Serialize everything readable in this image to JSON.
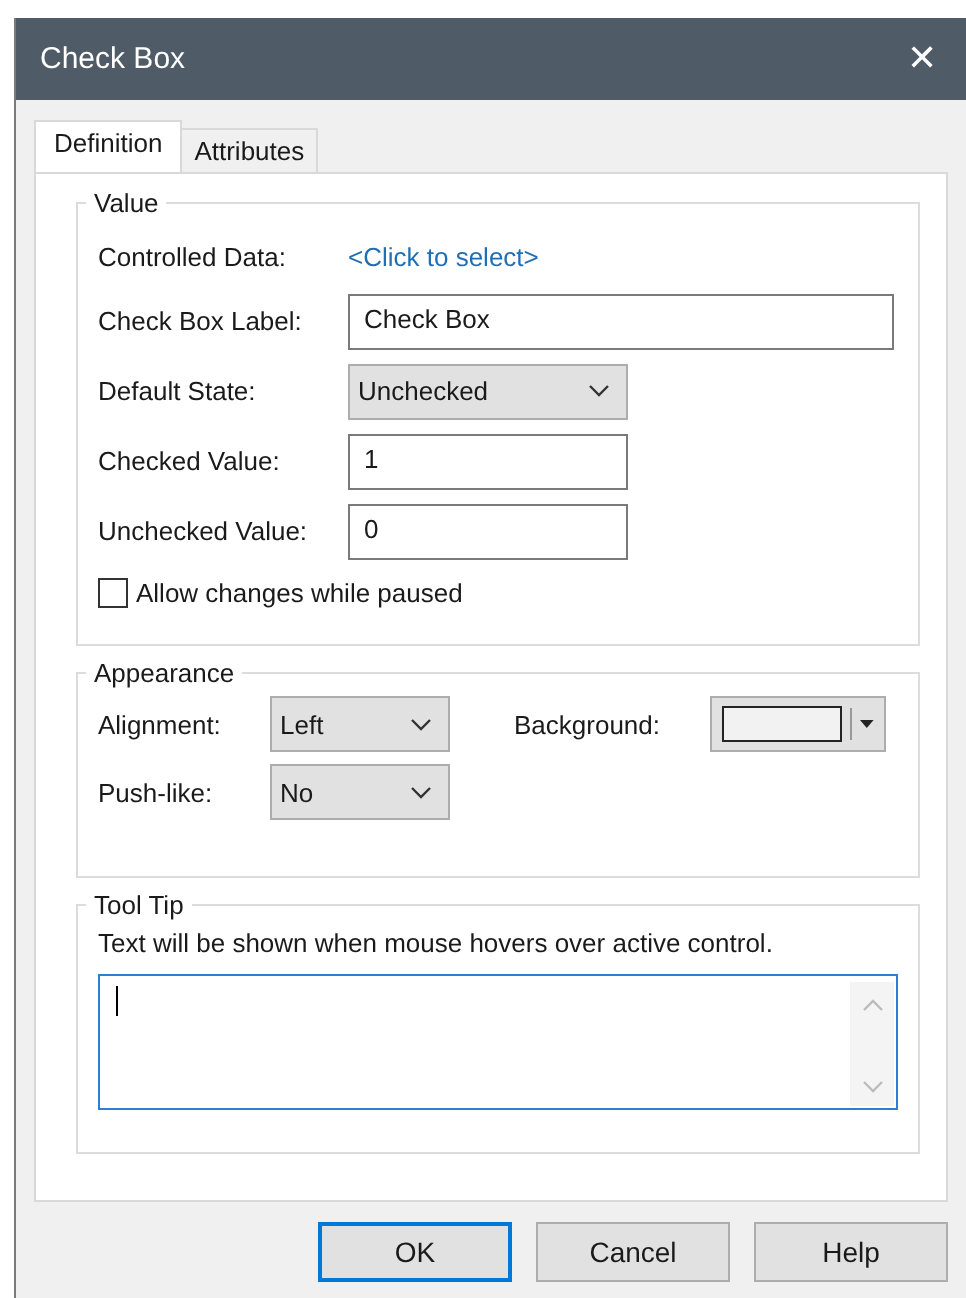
{
  "window": {
    "title": "Check Box",
    "close": "✕"
  },
  "tabs": [
    {
      "label": "Definition",
      "selected": true
    },
    {
      "label": "Attributes",
      "selected": false
    }
  ],
  "value_group": {
    "title": "Value",
    "controlled_data": {
      "label": "Controlled Data:",
      "link": "<Click to select>"
    },
    "fields": [
      {
        "kind": "text",
        "label": "Check Box Label:",
        "value": "Check Box"
      },
      {
        "kind": "dropdown",
        "label": "Default State:",
        "value": "Unchecked"
      },
      {
        "kind": "text",
        "label": "Checked Value:",
        "value": "1"
      },
      {
        "kind": "text",
        "label": "Unchecked Value:",
        "value": "0"
      }
    ],
    "checkbox": {
      "label": "Allow changes while paused",
      "checked": false
    }
  },
  "appearance_group": {
    "title": "Appearance",
    "alignment": {
      "label": "Alignment:",
      "value": "Left"
    },
    "push_like": {
      "label": "Push-like:",
      "value": "No"
    },
    "background": {
      "label": "Background:"
    }
  },
  "tool_tip_group": {
    "title": "Tool Tip",
    "description": "Text will be shown when mouse hovers over active control."
  },
  "buttons": [
    {
      "label": "OK",
      "default": true
    },
    {
      "label": "Cancel",
      "default": false
    },
    {
      "label": "Help",
      "default": false
    }
  ]
}
